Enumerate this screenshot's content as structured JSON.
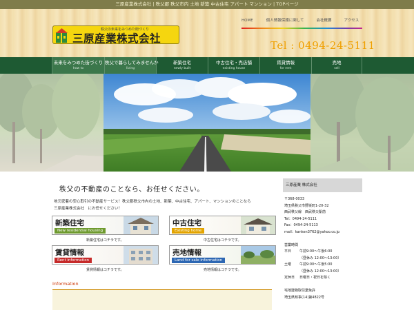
{
  "top_strip": "三原産業株式会社 | 秩父郡 秩父市内 土地 新築 中古住宅 アパート マンション | TOPページ",
  "logo": {
    "tagline": "秩父の未来をみつめた街づくり",
    "name": "三原産業株式会社",
    "colors": {
      "bg": "#f5d60f",
      "mark_green": "#2e8b3c",
      "mark_red": "#d43a2a"
    }
  },
  "top_nav": [
    "HOME",
    "個人情報保護に関して",
    "会社概要",
    "アクセス"
  ],
  "tel": "Tel : 0494-24-5111",
  "main_nav": [
    {
      "jp": "未来をみつめた街づくり",
      "en": "how to"
    },
    {
      "jp": "秩父で暮らしてみませんか",
      "en": "living"
    },
    {
      "jp": "新築住宅",
      "en": "newly built"
    },
    {
      "jp": "中古住宅・売店舗",
      "en": "existing house"
    },
    {
      "jp": "賃貸情報",
      "en": "for rent"
    },
    {
      "jp": "売地",
      "en": "sell"
    }
  ],
  "catch": "秩父の不動産のことなら、お任せください。",
  "intro": [
    "地元密着の安心取引の不動産サービス！秩父郡秩父市内の土地、新築、中古住宅、アパート、マンションのことなら",
    "三原産業株式会社　にお任せください！"
  ],
  "banners": [
    {
      "jp": "新築住宅",
      "en": "New residential housing",
      "en_color": "#6e9a2e",
      "caption": "新築住宅はコチラです。",
      "icon": "house-photo"
    },
    {
      "jp": "中古住宅",
      "en": "Existing home",
      "en_color": "#e3a400",
      "caption": "中古住宅はコチラです。",
      "icon": "house-photo"
    },
    {
      "jp": "賃貸情報",
      "en": "Rent information",
      "en_color": "#c62a2a",
      "caption": "賃貸情報はコチラです。",
      "icon": "apartment-photo"
    },
    {
      "jp": "売地情報",
      "en": "Land for sale information",
      "en_color": "#2d67b3",
      "caption": "売地情報はコチラです。",
      "icon": "land-photo"
    }
  ],
  "information_heading": "Information",
  "sidebar": {
    "title": "三原産業 株式会社",
    "address": [
      "〒368-0033",
      "埼玉県秩父市野坂町1-20-32",
      "西武秩父線　西武秩父駅前"
    ],
    "tel": "Tel：0494-24-5111",
    "fax": "Fax：0494-24-5113",
    "mail": "mail：kanken3762@yahoo.co.jp",
    "hours_title": "営業時間",
    "hours": [
      {
        "k": "平日",
        "v": "午前9:00～午後6:00"
      },
      {
        "k": "",
        "v": "（昼休み 12:00～13:00）"
      },
      {
        "k": "土曜",
        "v": "午前9:00～午後5:00"
      },
      {
        "k": "",
        "v": "（昼休み 12:00～13:00）"
      },
      {
        "k": "定休日",
        "v": "日曜日・祝日を除く"
      }
    ],
    "license": [
      "宅地建物取引業免許",
      "埼玉県知事(14)第4822号"
    ]
  }
}
